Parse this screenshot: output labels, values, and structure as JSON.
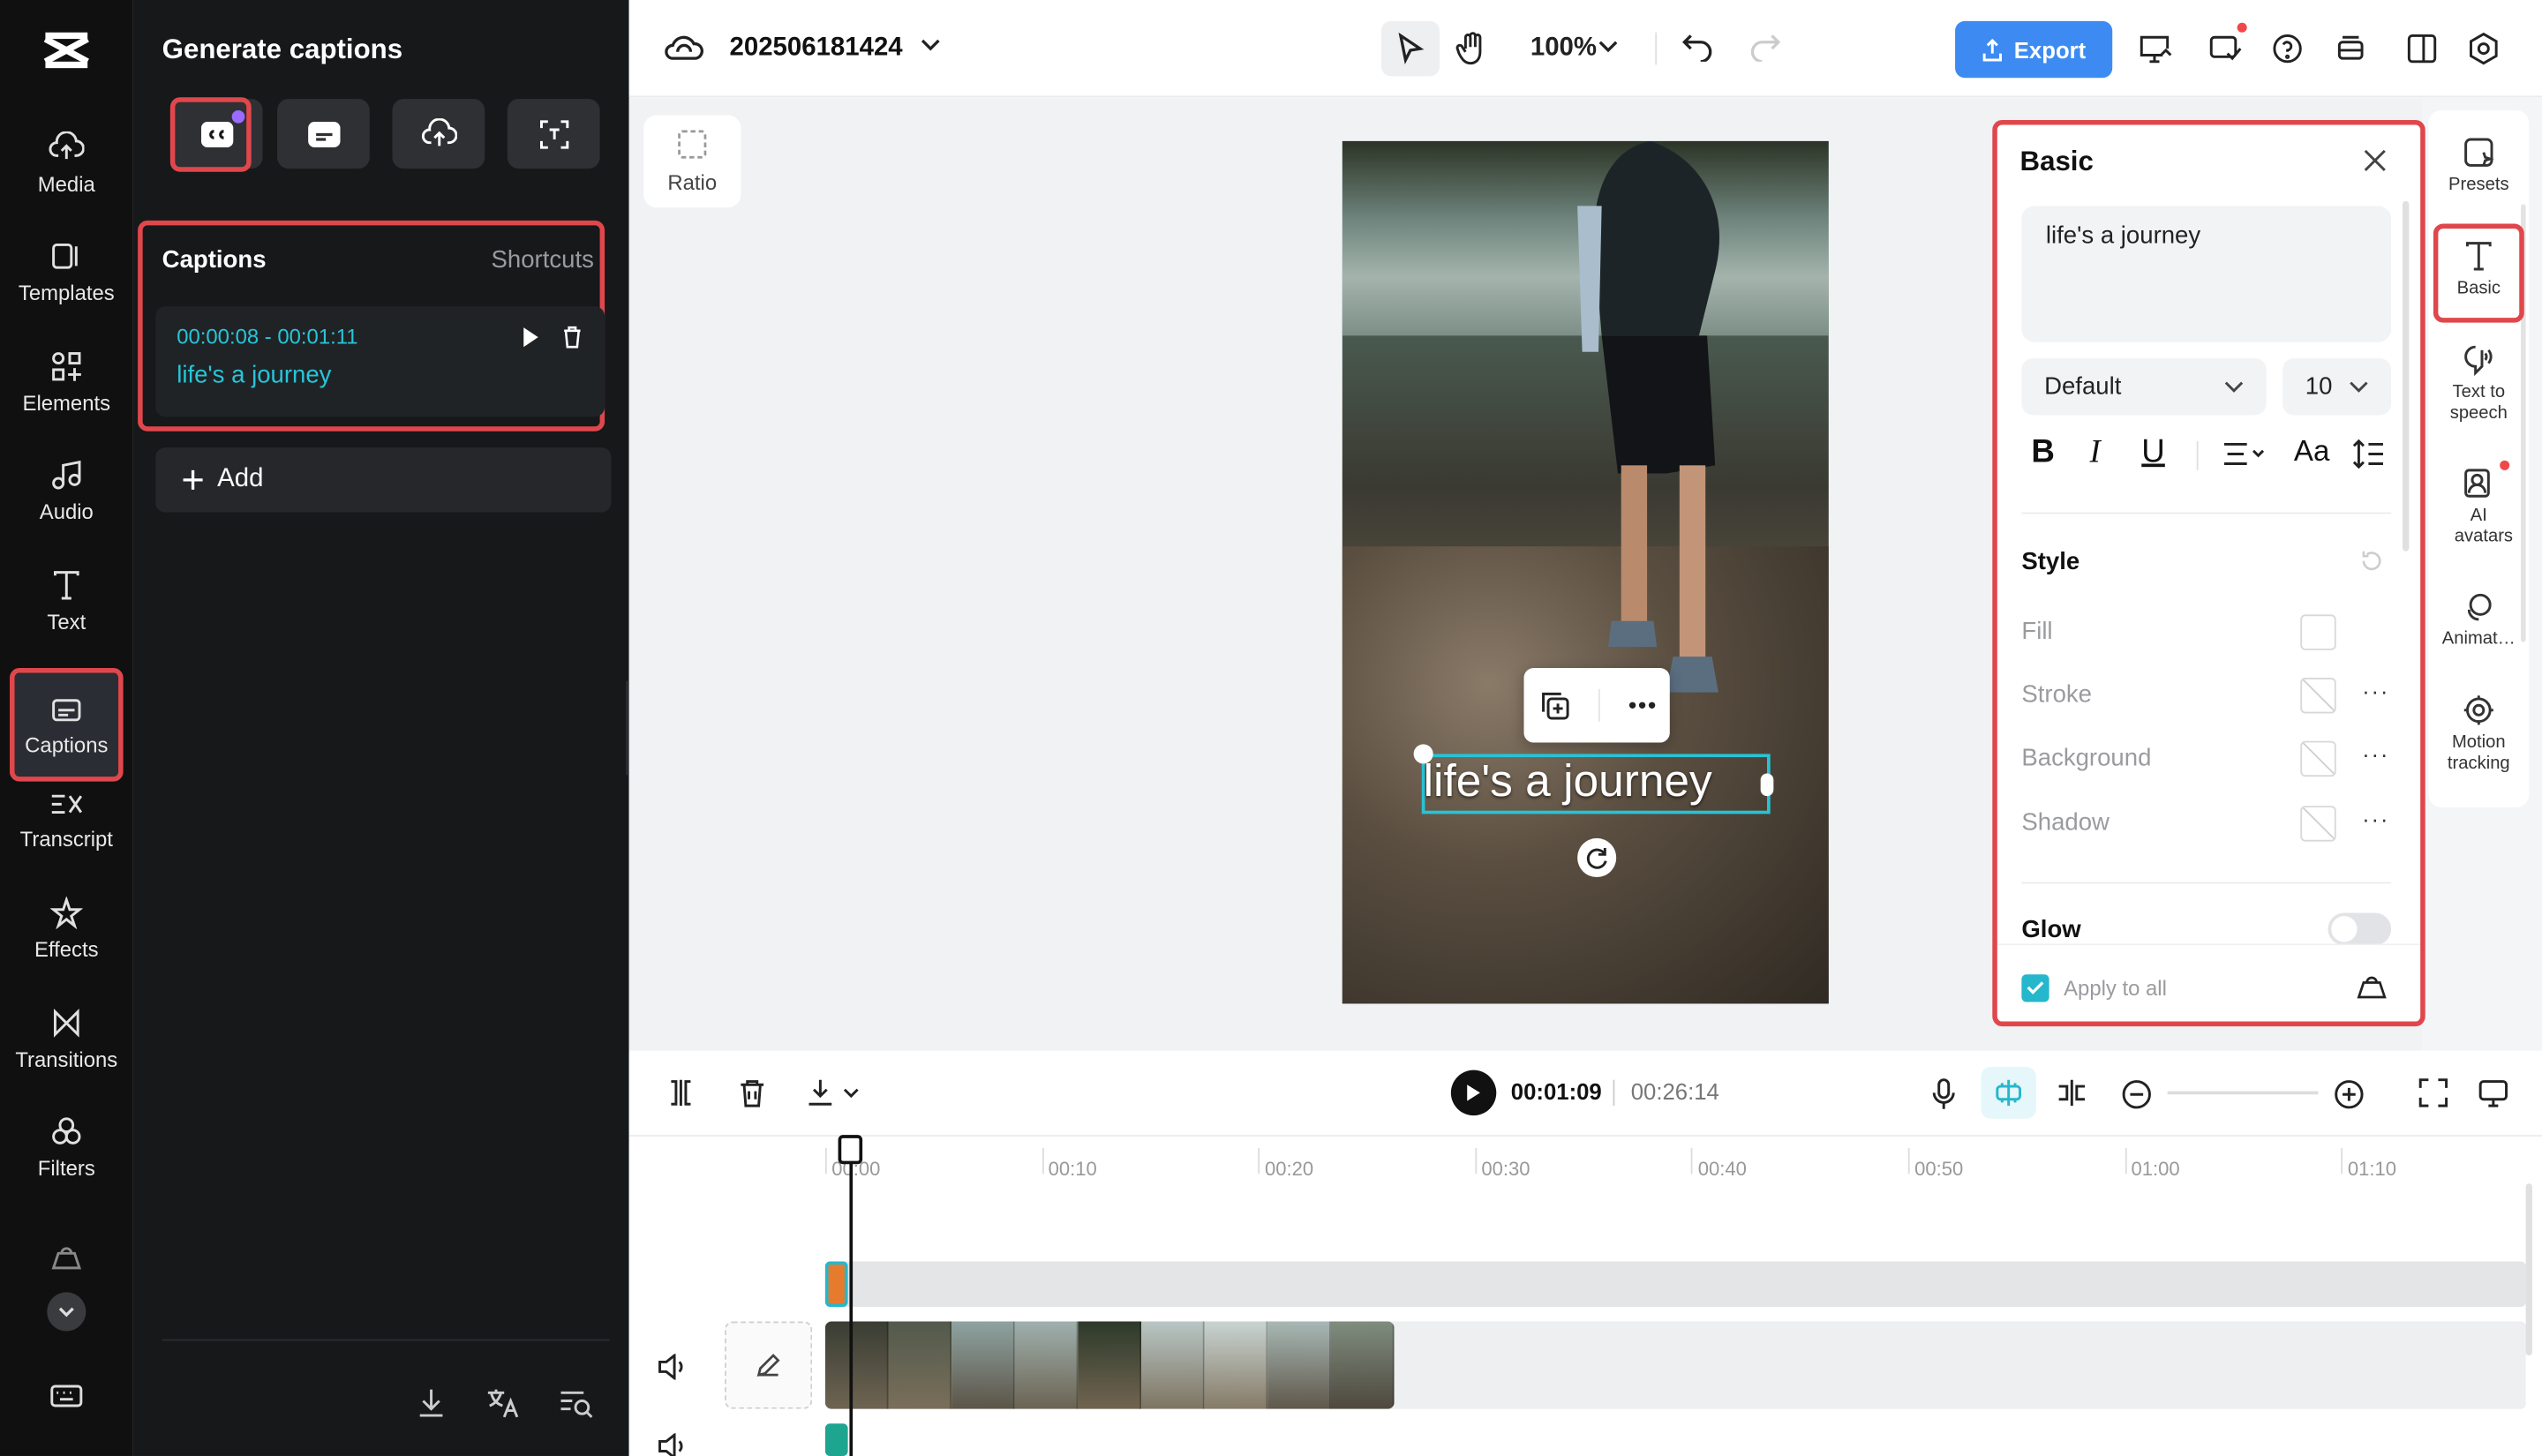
{
  "rail": {
    "items": [
      {
        "label": "Media",
        "icon": "cloud-upload-icon"
      },
      {
        "label": "Templates",
        "icon": "templates-icon"
      },
      {
        "label": "Elements",
        "icon": "elements-icon"
      },
      {
        "label": "Audio",
        "icon": "music-note-icon"
      },
      {
        "label": "Text",
        "icon": "text-icon"
      },
      {
        "label": "Captions",
        "icon": "captions-icon",
        "active": true
      },
      {
        "label": "Transcript",
        "icon": "transcript-icon"
      },
      {
        "label": "Effects",
        "icon": "effects-icon"
      },
      {
        "label": "Transitions",
        "icon": "transitions-icon"
      },
      {
        "label": "Filters",
        "icon": "filters-icon"
      }
    ]
  },
  "side": {
    "title": "Generate captions",
    "captions_title": "Captions",
    "shortcuts": "Shortcuts",
    "caption": {
      "time": "00:00:08 - 00:01:11",
      "text": "life's a journey"
    },
    "add_label": "Add"
  },
  "topbar": {
    "project_name": "202506181424",
    "zoom": "100%",
    "export_label": "Export"
  },
  "canvas": {
    "ratio_label": "Ratio",
    "subtitle": "life's a journey"
  },
  "panel": {
    "title": "Basic",
    "text_value": "life's a journey",
    "font": "Default",
    "font_size": "10",
    "style_title": "Style",
    "fill": "Fill",
    "stroke": "Stroke",
    "background": "Background",
    "shadow": "Shadow",
    "glow": "Glow",
    "apply_all": "Apply to all"
  },
  "right_rail": {
    "presets": "Presets",
    "basic": "Basic",
    "tts": "Text to speech",
    "avatars": "AI avatars",
    "animation": "Animat…",
    "motion": "Motion tracking"
  },
  "timeline": {
    "current": "00:01:09",
    "duration": "00:26:14",
    "ticks": [
      "00:00",
      "00:10",
      "00:20",
      "00:30",
      "00:40",
      "00:50",
      "01:00",
      "01:10"
    ]
  },
  "colors": {
    "accent": "#26c6d8",
    "highlight": "#e0474c",
    "export": "#3d8bf2"
  }
}
